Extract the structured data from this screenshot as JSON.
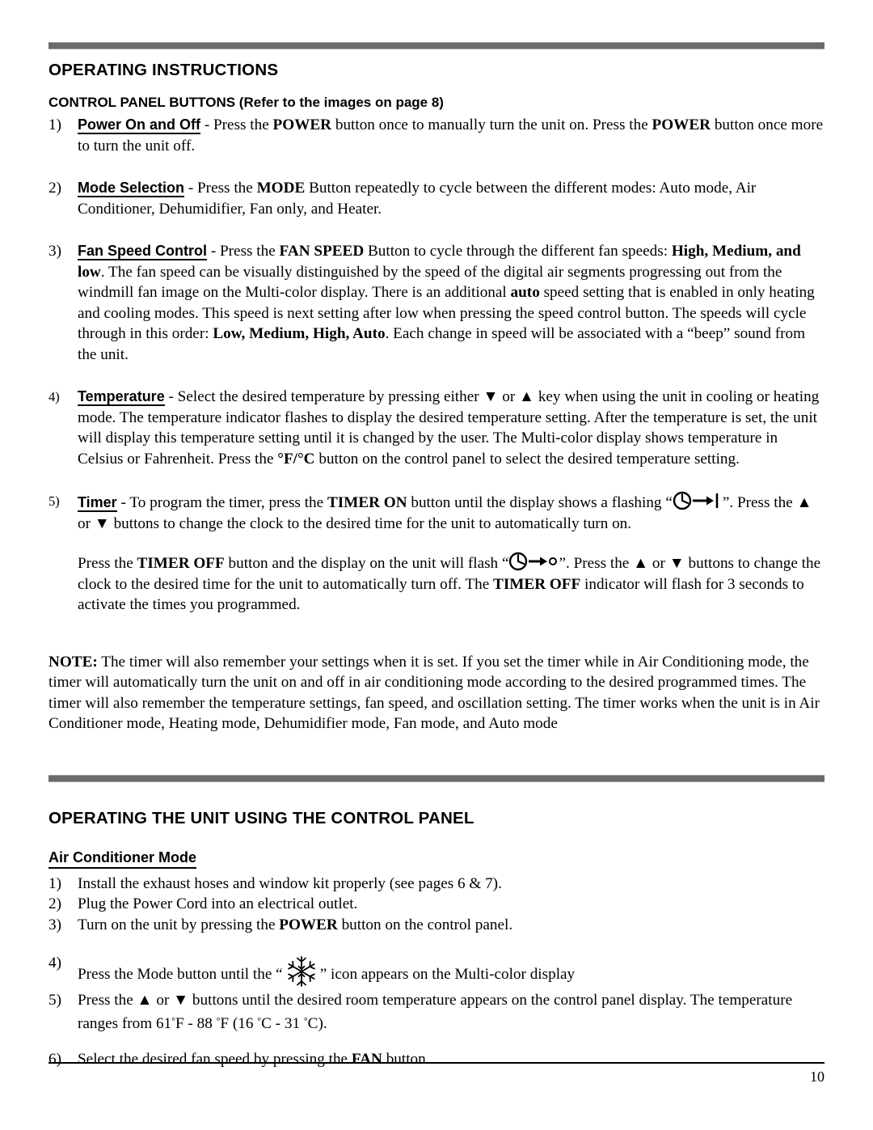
{
  "document": {
    "page_number": "10",
    "rule_color": "#6b6b6b"
  },
  "section1": {
    "heading": "OPERATING INSTRUCTIONS",
    "subheading": "CONTROL PANEL BUTTONS (Refer to the images on page 8)",
    "items": [
      {
        "number": "1)",
        "lead": "Power On and Off",
        "text_before_bold1": " - Press the ",
        "bold1": "POWER",
        "text_mid": " button once to manually turn the unit on. Press the ",
        "bold2": "POWER",
        "text_after": " button once more to turn the unit off."
      },
      {
        "number": "2)",
        "lead": "Mode Selection",
        "text_before_bold1": " - Press the ",
        "bold1": "MODE",
        "text_after": " Button repeatedly to cycle between the different modes: Auto mode, Air Conditioner, Dehumidifier, Fan only, and Heater."
      },
      {
        "number": "3)",
        "lead": "Fan Speed Control",
        "p1": " - Press the ",
        "b_fanspeed": "FAN SPEED",
        "p2": " Button to cycle through the different fan speeds: ",
        "b_speeds": "High, Medium, and low",
        "p3": ". The fan speed can be visually distinguished by the speed of the digital air segments progressing out from the windmill fan image on the Multi-color display. There is an additional ",
        "b_auto": "auto",
        "p4": " speed setting that is enabled in only heating and cooling modes. This speed is next setting after low when pressing the speed control button. The speeds will cycle through in this order: ",
        "b_order": "Low, Medium, High, Auto",
        "p5": ". Each change in speed will be associated with a “beep” sound from the unit."
      },
      {
        "number": "4)",
        "lead": "Temperature",
        "p1": " - Select the desired temperature by pressing either ",
        "arrow_down": "▼",
        "p2": " or ",
        "arrow_up": "▲",
        "p3": " key when using the unit in cooling or heating mode. The temperature indicator flashes to display the desired temperature setting. After the temperature is set, the unit will display this temperature setting until it is changed by the user. The Multi-color display shows temperature in Celsius or Fahrenheit.  Press the ",
        "b_fc": "°F/°C",
        "p4": " button on the control panel to select the desired temperature setting."
      },
      {
        "number": "5)",
        "lead": "Timer",
        "p1": " - To program the timer, press the ",
        "b_timer_on": "TIMER ON",
        "p2": " button until the display shows a flashing “",
        "icon1": "clock-arrow-bar-icon",
        "p3": "”. Press the ",
        "arrow_up": "▲",
        "p4": " or ",
        "arrow_down": "▼",
        "p5": " buttons to change the clock to the desired time for the unit to automatically turn on.",
        "q1": "Press the ",
        "b_timer_off1": "TIMER OFF",
        "q2": " button and the display on the unit will flash “",
        "icon2": "clock-arrow-circle-icon",
        "q3": "”.  Press the ",
        "q4": " or ",
        "q5": " buttons to change the clock to the desired time for the unit to automatically turn off.  The ",
        "b_timer_off2": "TIMER OFF",
        "q6": " indicator will flash for 3 seconds to activate the times you programmed."
      }
    ],
    "note": {
      "label": "NOTE:",
      "text": " The timer will also remember your settings when it is set. If you set the timer while in Air Conditioning mode, the timer will automatically turn the unit on and off in air conditioning mode according to the desired programmed times. The timer will also remember the temperature settings, fan speed, and oscillation setting. The timer works when the unit is in Air Conditioner mode, Heating mode, Dehumidifier mode, Fan mode, and Auto mode"
    }
  },
  "section2": {
    "heading": "OPERATING THE UNIT USING THE CONTROL PANEL",
    "subheading": "Air Conditioner Mode",
    "items": [
      {
        "number": "1)",
        "text": "Install the exhaust hoses and window kit properly (see pages 6 & 7)."
      },
      {
        "number": "2)",
        "text": "Plug the Power Cord into an electrical outlet."
      },
      {
        "number": "3)",
        "p1": "Turn on the unit by pressing the ",
        "b_power": "POWER",
        "p2": " button on the control panel."
      },
      {
        "number": "4)",
        "p1": "Press the Mode button until the “",
        "icon": "snowflake-icon",
        "p2": "” icon appears on the Multi-color display"
      },
      {
        "number": "5)",
        "p1": "Press the ",
        "arrow_up": "▲",
        "p2": " or ",
        "arrow_down": "▼",
        "p3": " buttons until the desired room temperature appears on the control panel display.  The temperature ranges from 61",
        "deg1": "°",
        "p4": "F - 88 ",
        "deg2": "°",
        "p5": "F (16 ",
        "deg3": "°",
        "p6": "C - 31 ",
        "deg4": "°",
        "p7": "C)."
      },
      {
        "number": "6)",
        "p1": "Select the desired fan speed by pressing the ",
        "b_fan": "FAN",
        "p2": " button."
      }
    ]
  }
}
